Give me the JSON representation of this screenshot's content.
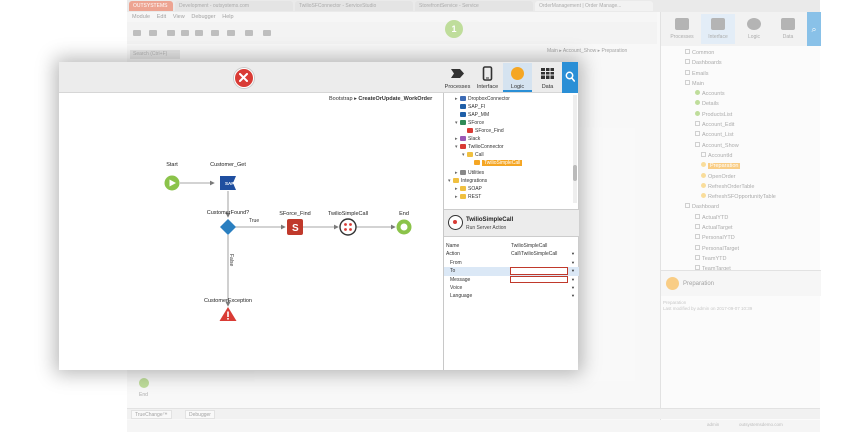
{
  "background_window": {
    "tabs": [
      "OUTSYSTEMS",
      "Development - outsystems.com",
      "TwilioSFConnector - ServiceStudio",
      "StorefrontService - Service",
      "OrderManagement | Order Manage..."
    ],
    "menu": [
      "Module",
      "Edit",
      "View",
      "Debugger",
      "Help"
    ],
    "search_tab": "Search (Ctrl+F)",
    "breadcrumb": "Main ▸ Account_Show ▸ Preparation",
    "right_tabs": [
      "Processes",
      "Interface",
      "Logic",
      "Data"
    ],
    "tree": [
      {
        "label": "Common",
        "icon": "box"
      },
      {
        "label": "Dashboards",
        "icon": "box"
      },
      {
        "label": "Emails",
        "icon": "box"
      },
      {
        "label": "Main",
        "icon": "box"
      },
      {
        "label": "Accounts",
        "icon": "check"
      },
      {
        "label": "Details",
        "icon": "check"
      },
      {
        "label": "ProductsList",
        "icon": "check"
      },
      {
        "label": "Account_Edit",
        "icon": "box"
      },
      {
        "label": "Account_List",
        "icon": "box"
      },
      {
        "label": "Account_Show",
        "icon": "box"
      },
      {
        "label": "AccountId",
        "icon": "box"
      },
      {
        "label": "Preparation",
        "icon": "dot",
        "selected": true
      },
      {
        "label": "OpenOrder",
        "icon": "dot"
      },
      {
        "label": "RefreshOrderTable",
        "icon": "dot"
      },
      {
        "label": "RefreshSFOpportunityTable",
        "icon": "dot"
      },
      {
        "label": "Dashboard",
        "icon": "box"
      },
      {
        "label": "ActualYTD",
        "icon": "box"
      },
      {
        "label": "ActualTarget",
        "icon": "box"
      },
      {
        "label": "PersonalYTD",
        "icon": "box"
      },
      {
        "label": "PersonalTarget",
        "icon": "box"
      },
      {
        "label": "TeamYTD",
        "icon": "box"
      },
      {
        "label": "TeamTarget",
        "icon": "box"
      }
    ],
    "preparation_label": "Preparation",
    "preparation_desc_1": "Preparation",
    "preparation_desc_2": "Last modified by admin on 2017-09-07 10:39",
    "status_tabs": [
      "TrueChange™",
      "Debugger"
    ],
    "end_label": "End",
    "bottom_status": [
      "admin",
      "outsystemsdemo.com"
    ]
  },
  "dialog": {
    "tabs": [
      {
        "id": "processes",
        "label": "Processes",
        "active": false
      },
      {
        "id": "interface",
        "label": "Interface",
        "active": false
      },
      {
        "id": "logic",
        "label": "Logic",
        "active": true
      },
      {
        "id": "data",
        "label": "Data",
        "active": false
      }
    ],
    "breadcrumb_prefix": "Bootstrap",
    "breadcrumb_sep": "▸",
    "breadcrumb_current": "CreateOrUpdate_WorkOrder",
    "flow": {
      "start": "Start",
      "customer_get": "Customer_Get",
      "customer_found": "CustomerFound?",
      "true_label": "True",
      "false_label": "False",
      "sforce_find": "SForce_Find",
      "twilio_call": "TwilioSimpleCall",
      "end": "End",
      "exception": "CustomerException"
    },
    "tree": [
      {
        "label": "DropboxConnector",
        "level": 1,
        "expander": "+",
        "icon_color": "#3c6bb5"
      },
      {
        "label": "SAP_FI",
        "level": 1,
        "expander": "",
        "icon_color": "#1f5fa8"
      },
      {
        "label": "SAP_MM",
        "level": 1,
        "expander": "",
        "icon_color": "#1f5fa8"
      },
      {
        "label": "SForce",
        "level": 1,
        "expander": "-",
        "icon_color": "#2e8b57"
      },
      {
        "label": "SForce_Find",
        "level": 2,
        "expander": "",
        "icon_color": "#d93b35"
      },
      {
        "label": "Slack",
        "level": 1,
        "expander": "+",
        "icon_color": "#9b59b6"
      },
      {
        "label": "TwilioConnector",
        "level": 1,
        "expander": "-",
        "icon_color": "#d93b35"
      },
      {
        "label": "Call",
        "level": 2,
        "expander": "-",
        "icon_color": "#f0c040"
      },
      {
        "label": "TwilioSimpleCall",
        "level": 3,
        "expander": "",
        "icon_color": "#f5a623",
        "selected": true
      },
      {
        "label": "Utilities",
        "level": 1,
        "expander": "+",
        "icon_color": "#888888"
      },
      {
        "label": "Integrations",
        "level": 0,
        "expander": "-",
        "icon_color": "#f0c040"
      },
      {
        "label": "SOAP",
        "level": 1,
        "expander": "+",
        "icon_color": "#f0c040"
      },
      {
        "label": "REST",
        "level": 1,
        "expander": "+",
        "icon_color": "#f0c040"
      }
    ],
    "properties_title": "TwilioSimpleCall",
    "properties_subtitle": "Run Server Action",
    "properties": [
      {
        "key": "Name",
        "value": "TwilioSimpleCall",
        "indent": false,
        "dropdown": false
      },
      {
        "key": "Action",
        "value": "Call\\TwilioSimpleCall",
        "indent": false,
        "dropdown": true
      },
      {
        "key": "From",
        "value": "",
        "indent": true,
        "dropdown": true
      },
      {
        "key": "To",
        "value": "",
        "indent": true,
        "dropdown": true,
        "selected": true,
        "error": true
      },
      {
        "key": "Message",
        "value": "",
        "indent": true,
        "dropdown": true,
        "error": true
      },
      {
        "key": "Voice",
        "value": "",
        "indent": true,
        "dropdown": true
      },
      {
        "key": "Language",
        "value": "",
        "indent": true,
        "dropdown": true
      }
    ],
    "colors": {
      "accent": "#2a8fd6",
      "close": "#d93b35",
      "start": "#8bc34a",
      "logic": "#f5a623",
      "error": "#c0392b"
    }
  }
}
